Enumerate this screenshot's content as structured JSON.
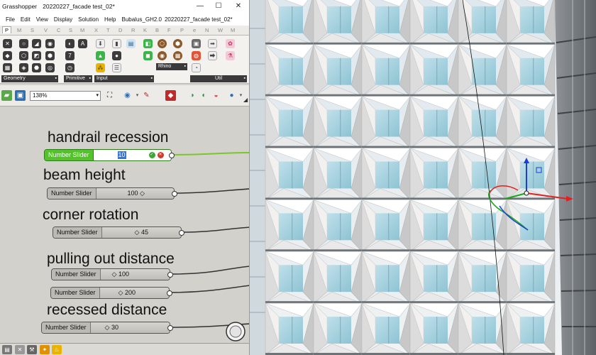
{
  "window": {
    "app_name": "Grasshopper",
    "doc_title": "20220227_facade test_02*",
    "controls": {
      "minimize": "—",
      "maximize": "☐",
      "close": "✕"
    }
  },
  "menu": [
    "File",
    "Edit",
    "View",
    "Display",
    "Solution",
    "Help",
    "Bubalus_GH2.0",
    "20220227_facade test_02*"
  ],
  "tabs": [
    "P",
    "M",
    "S",
    "V",
    "C",
    "S",
    "M",
    "X",
    "T",
    "D",
    "R",
    "K",
    "B",
    "F",
    "P",
    "e",
    "N",
    "W",
    "M"
  ],
  "ribbon_groups": [
    {
      "label": "Geometry"
    },
    {
      "label": "Primitive"
    },
    {
      "label": "Input"
    },
    {
      "label": "Rhino"
    },
    {
      "label": "Util"
    }
  ],
  "toolbar": {
    "zoom": "138%"
  },
  "sliders": [
    {
      "group_label": "handrail recession",
      "component": "Number Slider",
      "value": "10",
      "editing": true
    },
    {
      "group_label": "beam height",
      "component": "Number Slider",
      "value": "100 ◇"
    },
    {
      "group_label": "corner rotation",
      "component": "Number Slider",
      "value": "◇ 45"
    },
    {
      "group_label": "pulling out distance",
      "component": "Number Slider",
      "value": "◇ 100"
    },
    {
      "group_label": "",
      "component": "Number Slider",
      "value": "◇ 200"
    },
    {
      "group_label": "recessed distance",
      "component": "Number Slider",
      "value": "◇ 30"
    }
  ],
  "icons": [
    "zoom-dropdown-icon",
    "eye-icon",
    "sketch-icon",
    "bake-icon",
    "sphere-preview-icon",
    "save-icon",
    "open-icon",
    "point-icon",
    "curve-icon",
    "panel-icon",
    "gradient-icon"
  ],
  "colors": {
    "slider_active": "#53c22b",
    "wire_active": "#7bc62a",
    "selection": "#3875d7",
    "facade_panel": "#f2f1f0",
    "glass": "#a9d2dd"
  }
}
